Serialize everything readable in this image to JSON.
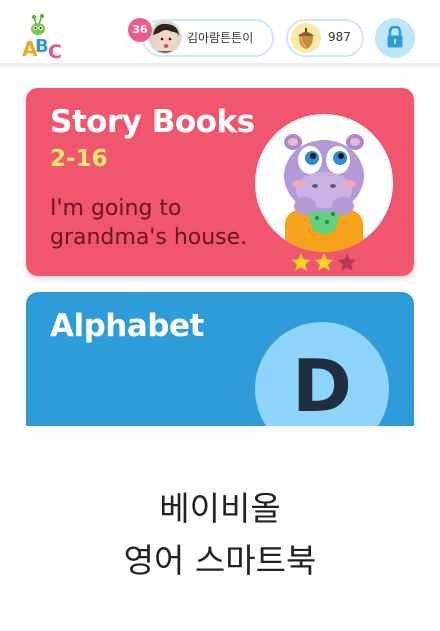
{
  "header": {
    "logo_icon": "abc-caterpillar-logo-icon",
    "level": "36",
    "user_name": "김아람튼튼이",
    "acorn_icon": "acorn-icon",
    "acorn_count": "987",
    "lock_icon": "lock-icon"
  },
  "cards": {
    "story": {
      "title": "Story Books",
      "code": "2-16",
      "subtitle": "I'm going to grandma's house.",
      "character_icon": "hippo-character-icon",
      "stars_filled": 2,
      "stars_total": 3,
      "color": "#f1566f"
    },
    "alphabet": {
      "title": "Alphabet",
      "letter": "D",
      "color": "#2e9cd9"
    }
  },
  "tagline": {
    "line1": "베이비올",
    "line2": "영어 스마트북"
  },
  "colors": {
    "accent_yellow": "#ffe96b",
    "level_pink": "#ef5b8a",
    "lock_bg": "#bfe6f7"
  }
}
